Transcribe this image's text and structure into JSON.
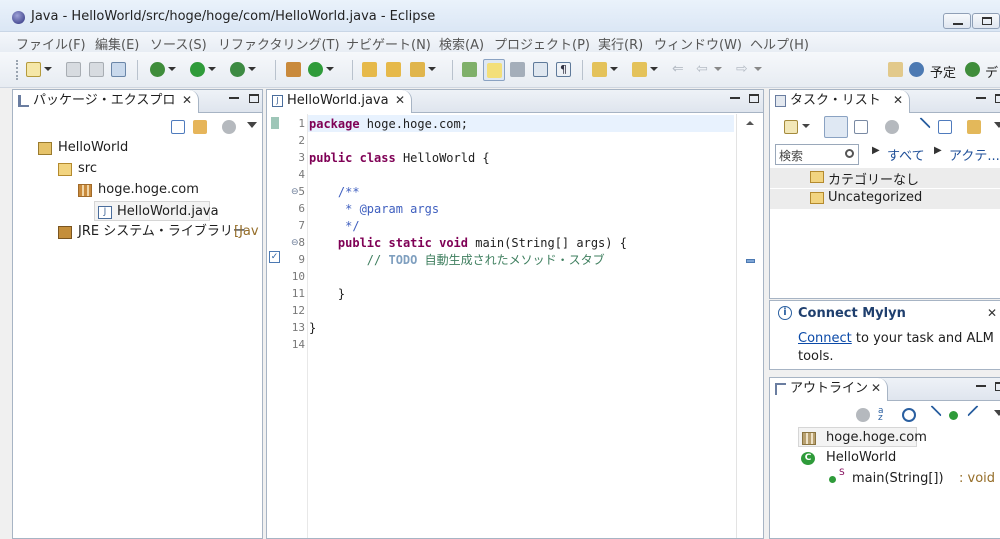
{
  "window": {
    "title": "Java - HelloWorld/src/hoge/hoge/com/HelloWorld.java - Eclipse"
  },
  "menu": [
    "ファイル(F)",
    "編集(E)",
    "ソース(S)",
    "リファクタリング(T)",
    "ナビゲート(N)",
    "検索(A)",
    "プロジェクト(P)",
    "実行(R)",
    "ウィンドウ(W)",
    "ヘルプ(H)"
  ],
  "toolbar": {
    "schedule_label": "予定",
    "debug_label": "デ"
  },
  "package_explorer": {
    "tab_label": "パッケージ・エクスプロ",
    "tree": [
      {
        "label": "HelloWorld",
        "icon": "project-icon",
        "level": 0
      },
      {
        "label": "src",
        "icon": "source-folder-icon",
        "level": 1
      },
      {
        "label": "hoge.hoge.com",
        "icon": "package-icon",
        "level": 2
      },
      {
        "label": "HelloWorld.java",
        "icon": "java-file-icon",
        "level": 3,
        "selected": true
      },
      {
        "label": "JRE システム・ライブラリー",
        "suffix": "[Jav",
        "icon": "library-icon",
        "level": 1
      }
    ]
  },
  "editor": {
    "tab_label": "HelloWorld.java",
    "lines": [
      {
        "n": "1",
        "parts": [
          [
            "kw",
            "package"
          ],
          [
            "",
            " hoge.hoge.com;"
          ]
        ]
      },
      {
        "n": "2",
        "parts": []
      },
      {
        "n": "3",
        "parts": [
          [
            "kw",
            "public"
          ],
          [
            "",
            " "
          ],
          [
            "kw",
            "class"
          ],
          [
            "",
            " HelloWorld {"
          ]
        ]
      },
      {
        "n": "4",
        "parts": []
      },
      {
        "n": "5",
        "parts": [
          [
            "",
            "    "
          ],
          [
            "cm",
            "/**"
          ]
        ],
        "fold": true
      },
      {
        "n": "6",
        "parts": [
          [
            "",
            "     "
          ],
          [
            "cm",
            "* @param args"
          ]
        ]
      },
      {
        "n": "7",
        "parts": [
          [
            "",
            "     "
          ],
          [
            "cm",
            "*/"
          ]
        ]
      },
      {
        "n": "8",
        "parts": [
          [
            "",
            "    "
          ],
          [
            "kw",
            "public"
          ],
          [
            "",
            " "
          ],
          [
            "kw",
            "static"
          ],
          [
            "",
            " "
          ],
          [
            "kw",
            "void"
          ],
          [
            "",
            " main(String[] args) {"
          ]
        ],
        "fold": true
      },
      {
        "n": "9",
        "parts": [
          [
            "",
            "        "
          ],
          [
            "cm2",
            "// "
          ],
          [
            "todo",
            "TODO"
          ],
          [
            "cm2",
            " 自動生成されたメソッド・スタブ"
          ]
        ]
      },
      {
        "n": "10",
        "parts": []
      },
      {
        "n": "11",
        "parts": [
          [
            "",
            "    }"
          ]
        ]
      },
      {
        "n": "12",
        "parts": []
      },
      {
        "n": "13",
        "parts": [
          [
            "",
            "}"
          ]
        ]
      },
      {
        "n": "14",
        "parts": []
      }
    ]
  },
  "task_list": {
    "tab_label": "タスク・リスト",
    "search_placeholder": "検索",
    "filter_all": "すべて",
    "filter_active": "アクテ...",
    "categories": [
      "カテゴリーなし",
      "Uncategorized"
    ]
  },
  "mylyn": {
    "title": "Connect Mylyn",
    "link_text": "Connect",
    "text_rest": " to your task and ALM",
    "text_line2": "tools."
  },
  "outline": {
    "tab_label": "アウトライン",
    "items": [
      {
        "label": "hoge.hoge.com",
        "icon": "package-declaration-icon",
        "selected": true
      },
      {
        "label": "HelloWorld",
        "icon": "class-icon"
      },
      {
        "label": "main(String[])",
        "suffix": " : void",
        "icon": "method-icon",
        "modifier": "S"
      }
    ]
  },
  "colors": {
    "keyword": "#7f0055",
    "javadoc": "#3f5fbf",
    "comment": "#3f7f5f",
    "link": "#0b4aa8",
    "current_line": "#e8f2fe"
  }
}
